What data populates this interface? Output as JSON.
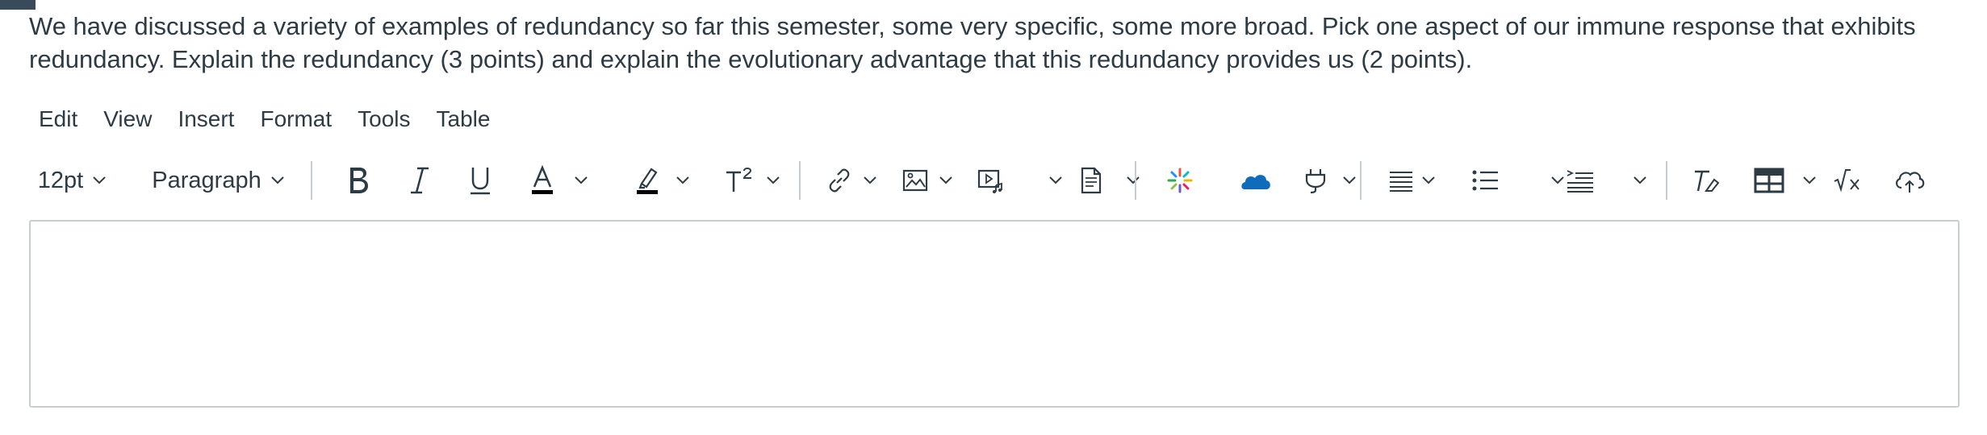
{
  "question": {
    "text": "We have discussed a variety of examples of redundancy so far this semester, some very specific, some more broad. Pick one aspect of our immune response that exhibits redundancy. Explain the redundancy (3 points) and explain the evolutionary advantage that this redundancy provides us (2 points)."
  },
  "menubar": {
    "items": [
      "Edit",
      "View",
      "Insert",
      "Format",
      "Tools",
      "Table"
    ]
  },
  "toolbar": {
    "font_size": "12pt",
    "block_format": "Paragraph",
    "icons": [
      "bold-icon",
      "italic-icon",
      "underline-icon",
      "text-color-icon",
      "highlight-icon",
      "superscript-icon",
      "link-icon",
      "image-icon",
      "media-icon",
      "document-icon",
      "apps-icon",
      "onedrive-icon",
      "plug-icon",
      "align-icon",
      "bullet-list-icon",
      "indent-icon",
      "clear-formatting-icon",
      "table-icon",
      "equation-icon",
      "cloud-icon"
    ],
    "colors": {
      "text_color_bar": "#000000",
      "highlight_bar": "#000000",
      "onedrive": "#0f6cbd"
    }
  },
  "editor": {
    "content": ""
  }
}
